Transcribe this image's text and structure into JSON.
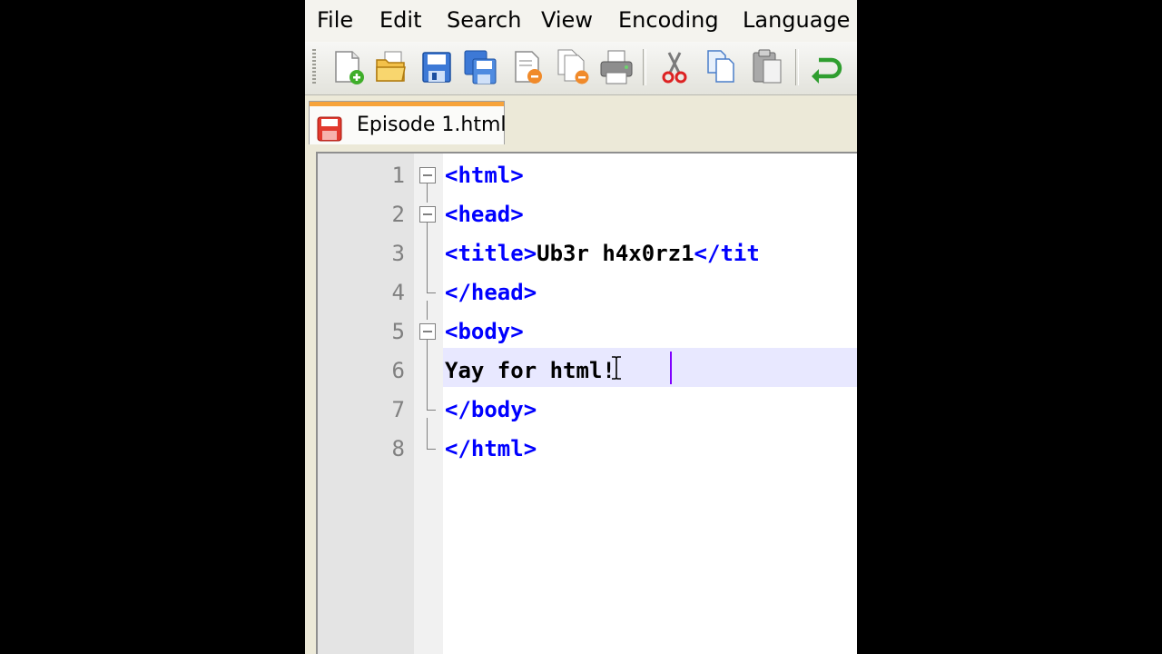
{
  "menu": {
    "items": [
      {
        "label": "File"
      },
      {
        "label": "Edit"
      },
      {
        "label": "Search"
      },
      {
        "label": "View"
      },
      {
        "label": "Encoding"
      },
      {
        "label": "Language"
      }
    ]
  },
  "toolbar": {
    "buttons": [
      {
        "name": "new-file-icon"
      },
      {
        "name": "open-file-icon"
      },
      {
        "name": "save-icon"
      },
      {
        "name": "save-all-icon"
      },
      {
        "name": "close-icon"
      },
      {
        "name": "close-all-icon"
      },
      {
        "name": "print-icon"
      },
      {
        "name": "cut-icon"
      },
      {
        "name": "copy-icon"
      },
      {
        "name": "paste-icon"
      },
      {
        "name": "undo-icon"
      }
    ]
  },
  "tab": {
    "label": "Episode 1.html",
    "icon": "unsaved-file-icon"
  },
  "editor": {
    "line_numbers": [
      "1",
      "2",
      "3",
      "4",
      "5",
      "6",
      "7",
      "8"
    ],
    "lines": [
      {
        "tag1": "<html>",
        "text": "",
        "tag2": ""
      },
      {
        "tag1": "<head>",
        "text": "",
        "tag2": ""
      },
      {
        "tag1": "<title>",
        "text": "Ub3r h4x0rz1",
        "tag2": "</tit"
      },
      {
        "tag1": "</head>",
        "text": "",
        "tag2": ""
      },
      {
        "tag1": "<body>",
        "text": "",
        "tag2": ""
      },
      {
        "tag1": "",
        "text": "Yay for html!",
        "tag2": ""
      },
      {
        "tag1": "</body>",
        "text": "",
        "tag2": ""
      },
      {
        "tag1": "</html>",
        "text": "",
        "tag2": ""
      }
    ],
    "current_line": "6"
  },
  "colors": {
    "tag": "#0000ff",
    "text": "#000000",
    "caret": "#8000ff",
    "tab_accent": "#f7a33a"
  }
}
